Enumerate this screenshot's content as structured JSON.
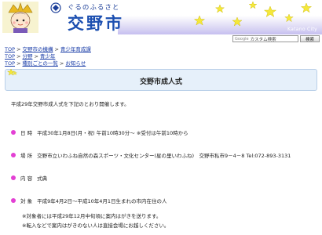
{
  "header": {
    "logo_tagline": "ぐるのふるさと",
    "logo_title": "交野市",
    "city_name": "Katano City"
  },
  "search": {
    "google_mark": "Google",
    "placeholder": "カスタム検索",
    "button_label": "検索"
  },
  "breadcrumbs": [
    [
      "TOP",
      "交野市の機構",
      "青少年育成課"
    ],
    [
      "TOP",
      "分野",
      "青少年"
    ],
    [
      "TOP",
      "種別ごとの一覧",
      "お知らせ"
    ]
  ],
  "page": {
    "title": "交野市成人式",
    "intro": "平成29年交野市成人式を下記のとおり開催します。",
    "items": [
      {
        "label": "日 時",
        "value": "平成30年1月8日(月・祝) 午前10時30分～ ※受付は午前10時から"
      },
      {
        "label": "場 所",
        "value": "交野市立いわふね自然の森スポーツ・文化センター(星の里いわふね)　交野市私市9－4－8 Tel:072-893-3131"
      },
      {
        "label": "内 容",
        "value": "式典"
      },
      {
        "label": "対 象",
        "value": "平成9年4月2日～平成10年4月1日生まれの市内在住の人"
      }
    ],
    "notes": [
      "※対象者には平成29年12月中旬頃に案内はがきを送ります。",
      "※転入などで案内はがきのない人は直接会場にお越しください。"
    ]
  },
  "colors": {
    "accent_bullet": "#e340d4",
    "link": "#1a3da8",
    "title_box_bg": "#e6f0fa",
    "logo_blue": "#1c4fb0"
  },
  "icons": [
    "mascot-icon",
    "logo-mark-icon",
    "star-icon",
    "google-icon"
  ]
}
